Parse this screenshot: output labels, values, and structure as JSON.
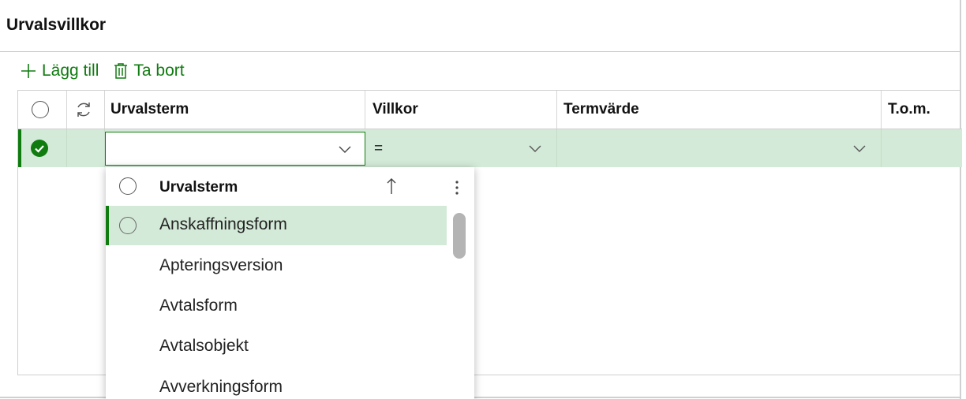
{
  "header": {
    "title": "Urvalsvillkor"
  },
  "toolbar": {
    "add_label": "Lägg till",
    "delete_label": "Ta bort"
  },
  "columns": {
    "term": "Urvalsterm",
    "condition": "Villkor",
    "value": "Termvärde",
    "to": "T.o.m."
  },
  "row": {
    "term_value": "",
    "condition_value": "=",
    "term_value_value": ""
  },
  "dropdown": {
    "header": "Urvalsterm",
    "items": [
      "Anskaffningsform",
      "Apteringsversion",
      "Avtalsform",
      "Avtalsobjekt",
      "Avverkningsform"
    ],
    "selected_index": 0
  },
  "colors": {
    "accent": "#107c10",
    "selected_bg": "#d4ead8"
  }
}
